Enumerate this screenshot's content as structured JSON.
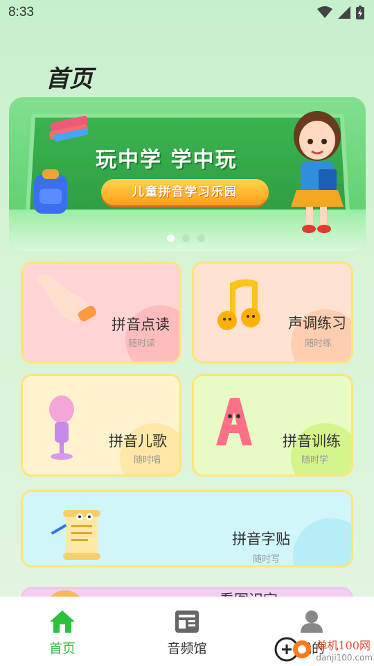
{
  "status": {
    "time": "8:33"
  },
  "page": {
    "title": "首页"
  },
  "banner": {
    "headline": "玩中学  学中玩",
    "pill": "儿童拼音学习乐园",
    "dots": 3,
    "active_dot": 0
  },
  "cards": [
    {
      "id": "pinyin-reading",
      "title": "拼音点读",
      "sub": "随时读",
      "bg": "#ffd4d4",
      "blob": "#ffbcbc"
    },
    {
      "id": "tone-practice",
      "title": "声调练习",
      "sub": "随时练",
      "bg": "#ffe3d2",
      "blob": "#ffcdb0"
    },
    {
      "id": "pinyin-songs",
      "title": "拼音儿歌",
      "sub": "随时唱",
      "bg": "#fff3cf",
      "blob": "#ffe7a8"
    },
    {
      "id": "pinyin-training",
      "title": "拼音训练",
      "sub": "随时学",
      "bg": "#e9fbc4",
      "blob": "#d4f58c"
    },
    {
      "id": "pinyin-writing",
      "title": "拼音字贴",
      "sub": "随时写",
      "bg": "#d0f6fa",
      "blob": "#b5eef6"
    },
    {
      "id": "look-learn-words",
      "title": "看图识字"
    }
  ],
  "tabbar": {
    "items": [
      {
        "label": "首页",
        "icon": "home-icon",
        "active": true
      },
      {
        "label": "音频馆",
        "icon": "audio-library-icon",
        "active": false
      },
      {
        "label": "我的",
        "icon": "profile-icon",
        "active": false
      }
    ]
  },
  "watermark": {
    "text1": "单机100网",
    "text2": "danji100.com"
  },
  "colors": {
    "accent": "#2fbf3f",
    "card_border": "#ffe57a"
  }
}
